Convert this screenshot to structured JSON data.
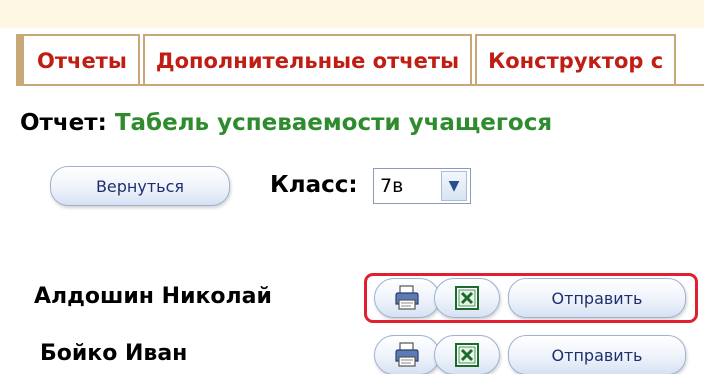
{
  "tabs": [
    {
      "label": "Отчеты"
    },
    {
      "label": "Дополнительные отчеты"
    },
    {
      "label": "Конструктор с"
    }
  ],
  "report": {
    "prefix": "Отчет:",
    "name": "Табель успеваемости учащегося"
  },
  "controls": {
    "back_label": "Вернуться",
    "class_label": "Класс:",
    "class_value": "7в"
  },
  "students": [
    {
      "name": "Алдошин Николай",
      "send_label": "Отправить"
    },
    {
      "name": "Бойко Иван",
      "send_label": "Отправить"
    }
  ],
  "colors": {
    "tab_text": "#c01d14",
    "report_name": "#2e8b2e",
    "highlight": "#e02030"
  },
  "icons": {
    "print": "printer-icon",
    "excel": "excel-icon",
    "dropdown": "chevron-down-icon"
  }
}
